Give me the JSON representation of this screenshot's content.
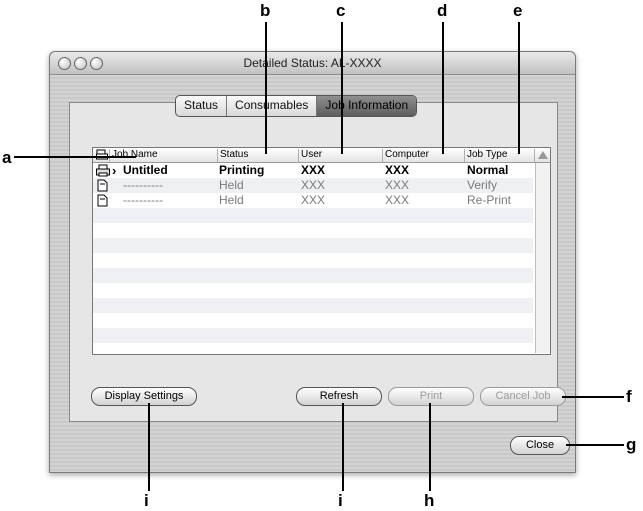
{
  "window": {
    "title": "Detailed Status: AL-XXXX",
    "tabs": [
      {
        "label": "Status",
        "active": false
      },
      {
        "label": "Consumables",
        "active": false
      },
      {
        "label": "Job Information",
        "active": true
      }
    ]
  },
  "table": {
    "headers": [
      "Job Name",
      "Status",
      "User",
      "Computer",
      "Job Type"
    ],
    "rows": [
      {
        "job_name": "Untitled",
        "status": "Printing",
        "user": "XXX",
        "computer": "XXX",
        "job_type": "Normal",
        "style": "bold",
        "current": true
      },
      {
        "job_name": "----------",
        "status": "Held",
        "user": "XXX",
        "computer": "XXX",
        "job_type": "Verify",
        "style": "dim",
        "current": false
      },
      {
        "job_name": "----------",
        "status": "Held",
        "user": "XXX",
        "computer": "XXX",
        "job_type": "Re-Print",
        "style": "dim",
        "current": false
      }
    ]
  },
  "buttons": {
    "display_settings": "Display Settings",
    "refresh": "Refresh",
    "print": "Print",
    "cancel_job": "Cancel Job",
    "close": "Close"
  },
  "callouts": {
    "a": "a",
    "b": "b",
    "c": "c",
    "d": "d",
    "e": "e",
    "f": "f",
    "g": "g",
    "h": "h",
    "i_left": "i",
    "i_right": "i"
  },
  "colors": {
    "window_bg": "#c9c9c9",
    "active_tab": "#6f6f6f",
    "alt_row": "#eef0f4",
    "dim_text": "#7b7b7b"
  }
}
